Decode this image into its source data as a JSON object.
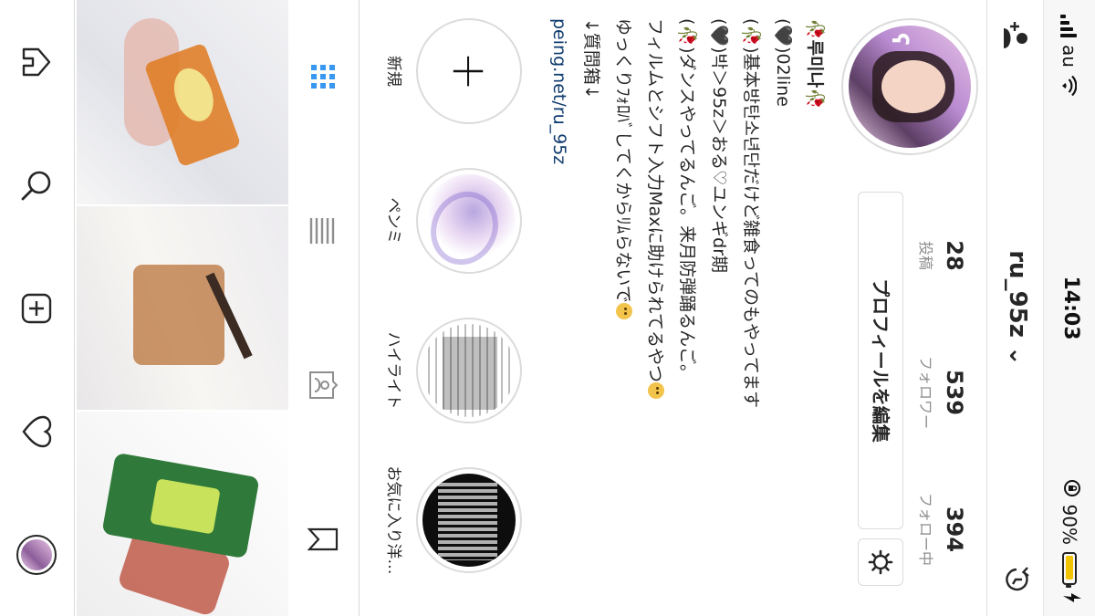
{
  "status_bar": {
    "carrier": "au",
    "time": "14:03",
    "battery_percent": "90%",
    "battery_level": 0.9
  },
  "header": {
    "username": "ru_95z",
    "chevron": "⌄"
  },
  "stats": {
    "posts": {
      "number": "28",
      "label": "投稿"
    },
    "followers": {
      "number": "539",
      "label": "フォロワー"
    },
    "following": {
      "number": "394",
      "label": "フォロー中"
    }
  },
  "buttons": {
    "edit_profile": "プロフィールを編集"
  },
  "bio": {
    "name": "루미나",
    "line_02": "02line",
    "line_likes": "基本방탄소년단だけど雑食ってのもやってます",
    "line_ship": "박＞95z＞おる♡ユンギdr期",
    "line_dance": "ダンスやってるんご。来月防弾踊るんご。",
    "line_film": "フィルムとシフト入力Maxに助けられてるやつ",
    "line_follow": "ゆっくりﾌｫﾛﾊﾞしてくからﾘﾑらないで",
    "line_question": "↓質問箱↓",
    "link": "peing.net/ru_95z"
  },
  "highlights": [
    {
      "label": "新規"
    },
    {
      "label": "ペンミ"
    },
    {
      "label": "ハイライト"
    },
    {
      "label": "お気に入り洋…"
    }
  ],
  "icons": {
    "add_user": "add-person-icon",
    "history": "history-icon",
    "gear": "gear-icon",
    "grid": "grid-icon",
    "list": "list-icon",
    "tagged": "tagged-icon",
    "saved": "bookmark-icon",
    "home": "home-icon",
    "search": "search-icon",
    "add": "add-post-icon",
    "activity": "heart-icon",
    "profile": "profile-avatar"
  },
  "colors": {
    "accent_blue": "#3897f0",
    "link": "#0f3b6e",
    "battery": "#f2c400"
  }
}
